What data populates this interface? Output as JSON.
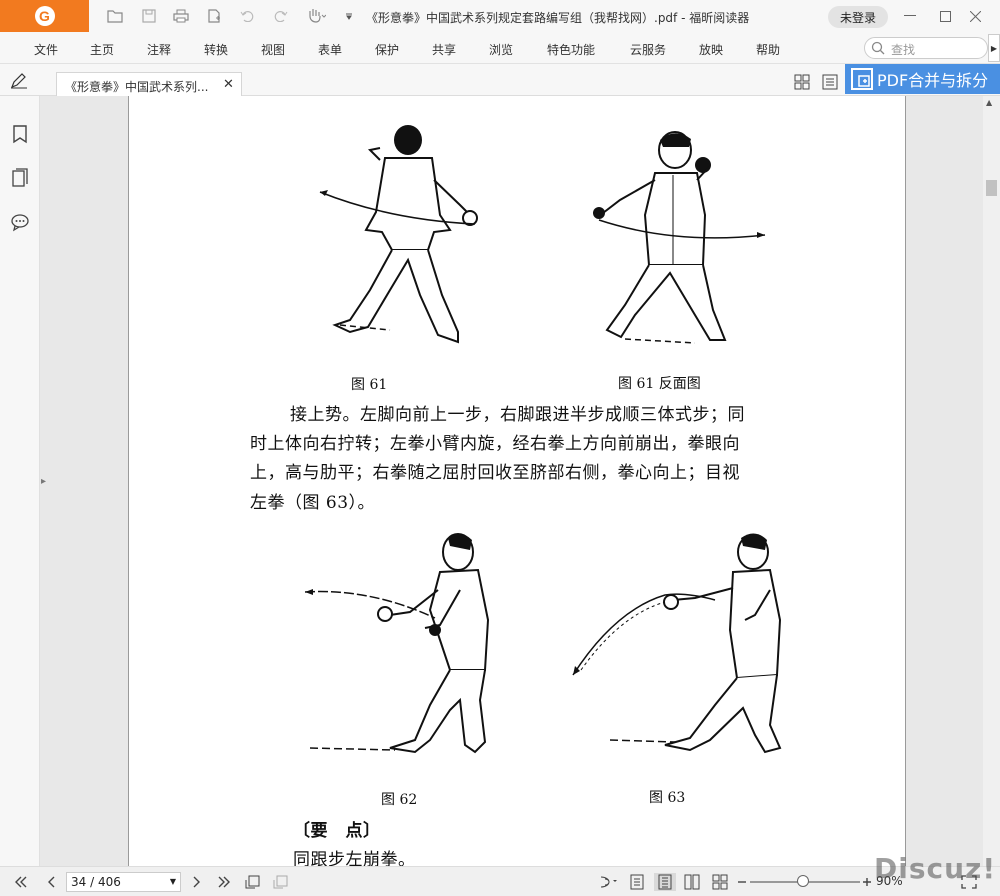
{
  "window": {
    "title": "《形意拳》中国武术系列规定套路编写组（我帮找网）.pdf - 福昕阅读器",
    "login_label": "未登录"
  },
  "menu": {
    "items": [
      "文件",
      "主页",
      "注释",
      "转换",
      "视图",
      "表单",
      "保护",
      "共享",
      "浏览",
      "特色功能",
      "云服务",
      "放映",
      "帮助"
    ],
    "search_placeholder": "查找"
  },
  "tabs": {
    "active_label": "《形意拳》中国武术系列...",
    "close_glyph": "✕"
  },
  "banner": {
    "label": "PDF合并与拆分"
  },
  "page": {
    "captions": {
      "fig61": "图 61",
      "fig61_back": "图 61 反面图",
      "fig62": "图 62",
      "fig63": "图 63"
    },
    "paragraph": [
      "接上势。左脚向前上一步，右脚跟进半步成顺三体式步；同",
      "时上体向右拧转；左拳小臂内旋，经右拳上方向前崩出，拳眼向",
      "上，高与肋平；右拳随之屈肘回收至脐部右侧，拳心向上；目视",
      "左拳（图 63）。"
    ],
    "key_points_heading": "〔要　点〕",
    "key_points_text": "同跟步左崩拳。"
  },
  "status": {
    "page_indicator": "34 / 406",
    "zoom": "90%"
  },
  "watermark": "Discuz!",
  "colors": {
    "brand": "#f27a1f",
    "banner": "#4a90e2"
  }
}
